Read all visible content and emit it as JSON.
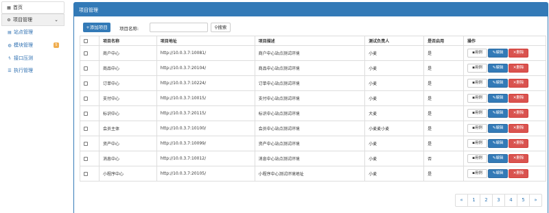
{
  "sidebar": {
    "home": "首页",
    "mgmt": "项目管理",
    "items": [
      {
        "label": "站点管理",
        "icon": "sitemap-icon"
      },
      {
        "label": "模块管理",
        "icon": "globe-icon",
        "badge": "5"
      },
      {
        "label": "接口压测",
        "icon": "bolt-icon"
      },
      {
        "label": "执行管理",
        "icon": "list-icon"
      }
    ]
  },
  "panel": {
    "title": "项目管理"
  },
  "toolbar": {
    "add_label": "添加项目",
    "name_label": "项目名称:",
    "name_value": "",
    "search_label": "搜索"
  },
  "table": {
    "headers": [
      "项目名称",
      "项目地址",
      "项目描述",
      "测试负责人",
      "是否启用",
      "操作"
    ],
    "rows": [
      {
        "name": "商户中心",
        "url": "http://10.0.3.7:10081/",
        "desc": "商户中心站点测试环境",
        "owner": "小麦",
        "enabled": "是"
      },
      {
        "name": "商品中心",
        "url": "http://10.0.3.7:20104/",
        "desc": "商品中心站点测试环境",
        "owner": "小麦",
        "enabled": "是"
      },
      {
        "name": "订单中心",
        "url": "http://10.0.3.7:10224/",
        "desc": "订单中心站点测试环境",
        "owner": "小麦",
        "enabled": "是"
      },
      {
        "name": "支付中心",
        "url": "http://10.0.3.7:10015/",
        "desc": "支付中心站点测试环境",
        "owner": "小麦",
        "enabled": "是"
      },
      {
        "name": "标识中心",
        "url": "http://10.0.3.7:20115/",
        "desc": "标识中心站点测试环境",
        "owner": "大麦",
        "enabled": "是"
      },
      {
        "name": "会员主体",
        "url": "http://10.0.3.7:10100/",
        "desc": "会员中心站点测试环境",
        "owner": "小麦麦小麦",
        "enabled": "是"
      },
      {
        "name": "资产中心",
        "url": "http://10.0.3.7:10099/",
        "desc": "资产中心站点测试环境",
        "owner": "小麦",
        "enabled": "是"
      },
      {
        "name": "消息中心",
        "url": "http://10.0.3.7:10012/",
        "desc": "消息中心站点测试环境",
        "owner": "小麦",
        "enabled": "否"
      },
      {
        "name": "小程序中心",
        "url": "http://10.0.3.7:20105/",
        "desc": "小程序中心测试环境地址",
        "owner": "小麦",
        "enabled": "是"
      }
    ],
    "op_case": "用例",
    "op_edit": "编辑",
    "op_delete": "删除"
  },
  "pagination": [
    "«",
    "1",
    "2",
    "3",
    "4",
    "5",
    "»"
  ],
  "colors": {
    "primary": "#337ab7",
    "danger": "#d9534f",
    "warning": "#f0ad4e"
  }
}
